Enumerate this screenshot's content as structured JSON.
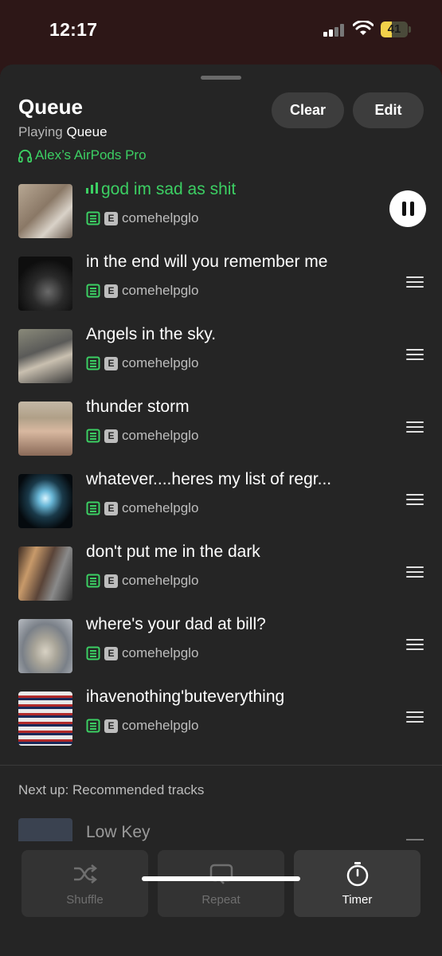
{
  "status": {
    "time": "12:17",
    "battery": "41",
    "battery_level": 0.41
  },
  "header": {
    "title": "Queue",
    "subtitle_prefix": "Playing",
    "subtitle_source": "Queue",
    "device": "Alex’s AirPods Pro",
    "clear_label": "Clear",
    "edit_label": "Edit"
  },
  "tracks": [
    {
      "title": "god im sad as shit",
      "artist": "comehelpglo",
      "playing": true
    },
    {
      "title": "in the end will you remember me",
      "artist": "comehelpglo"
    },
    {
      "title": "Angels in the sky.",
      "artist": "comehelpglo"
    },
    {
      "title": "thunder storm",
      "artist": "comehelpglo"
    },
    {
      "title": "whatever....heres my list of regr...",
      "artist": "comehelpglo"
    },
    {
      "title": "don't put me in the dark",
      "artist": "comehelpglo"
    },
    {
      "title": "where's your dad at bill?",
      "artist": "comehelpglo"
    },
    {
      "title": "ihavenothing'buteverything",
      "artist": "comehelpglo"
    }
  ],
  "explicit_badge": "E",
  "next_up": {
    "label": "Next up: Recommended tracks",
    "peek_title": "Low Key"
  },
  "toolbar": {
    "shuffle": "Shuffle",
    "repeat": "Repeat",
    "timer": "Timer"
  },
  "colors": {
    "accent": "#3ccf63",
    "sheet": "#252525",
    "backdrop": "#2d1717"
  },
  "icons": [
    "headphones-icon",
    "equalizer-icon",
    "downloaded-icon",
    "explicit-icon",
    "pause-icon",
    "drag-handle-icon",
    "shuffle-icon",
    "repeat-icon",
    "timer-icon"
  ]
}
